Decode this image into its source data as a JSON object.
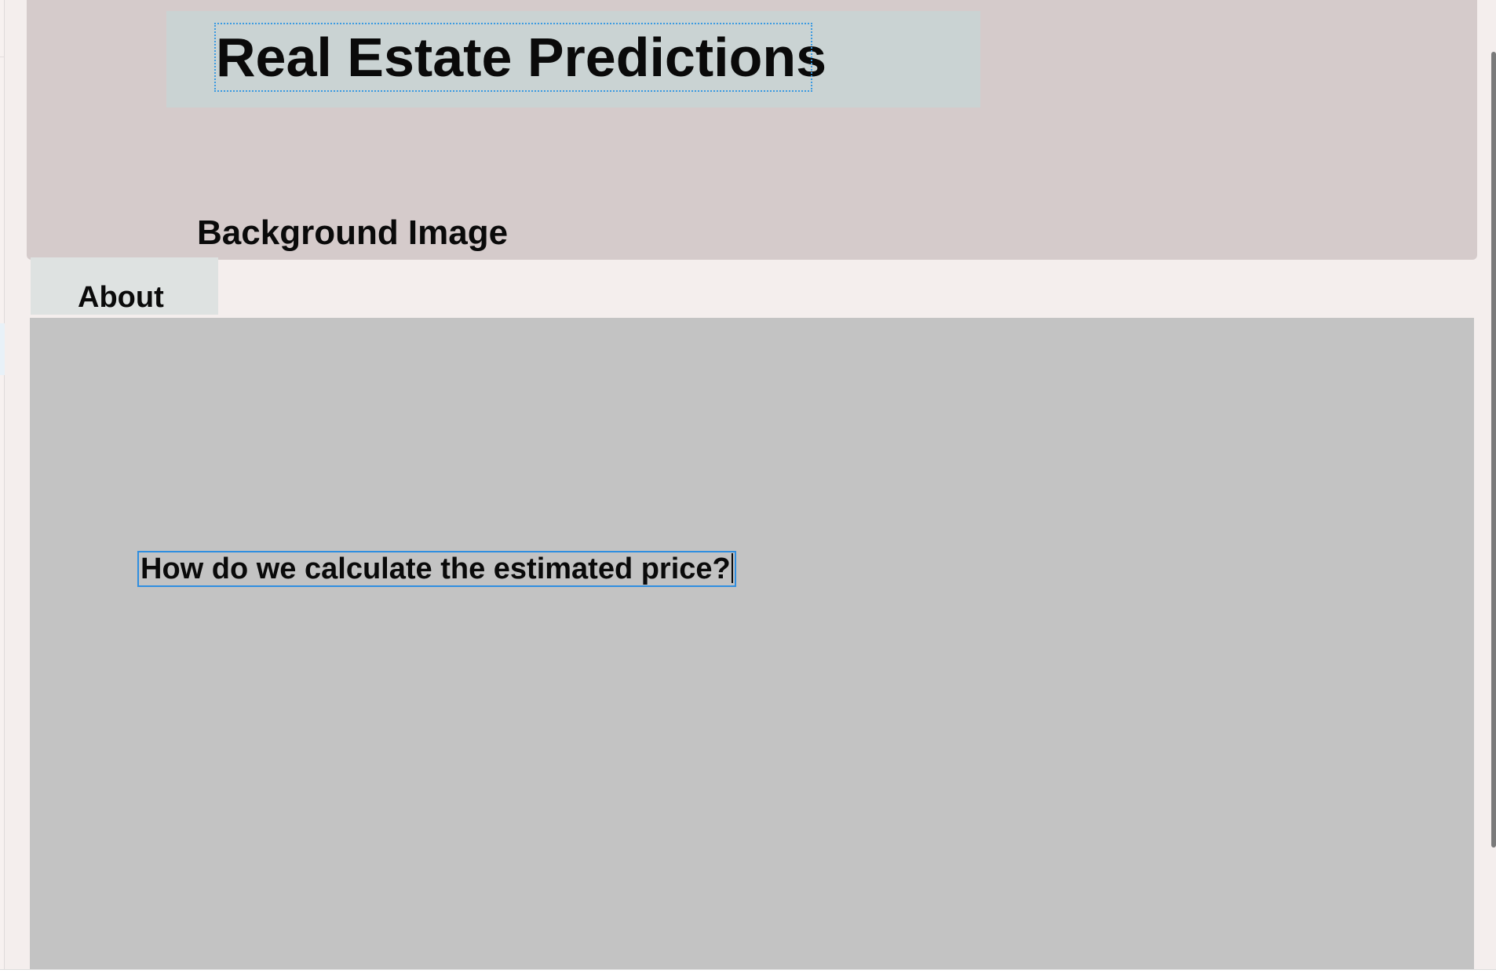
{
  "header": {
    "title": "Real Estate Predictions",
    "background_label": "Background Image"
  },
  "tabs": [
    {
      "label": "About"
    }
  ],
  "content": {
    "question_text": "How do we calculate the estimated price?"
  },
  "colors": {
    "canvas_background": "#f4eeed",
    "hero_background": "#d5cbcb",
    "title_panel_background": "#cad3d3",
    "tab_background": "#dee2e1",
    "content_background": "#c3c3c3",
    "selection_outline": "#2f8ee0"
  }
}
